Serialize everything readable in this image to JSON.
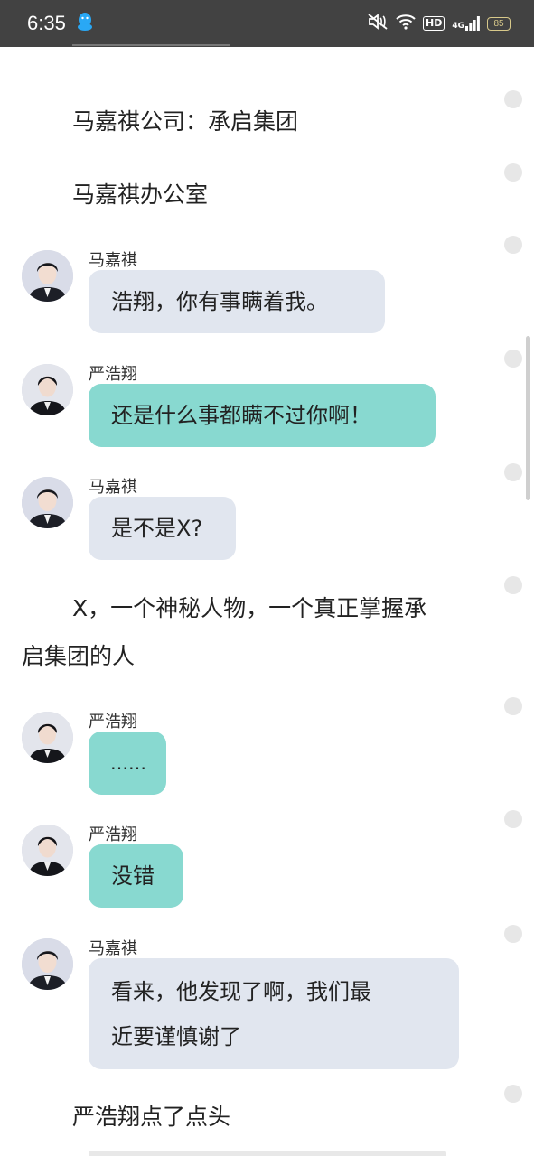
{
  "status_bar": {
    "time": "6:35",
    "hd": "HD",
    "network": "4G",
    "battery": "85",
    "icons": [
      "qq-icon",
      "mute-icon",
      "wifi-icon",
      "hd-icon",
      "signal-icon",
      "battery-icon"
    ]
  },
  "narration": {
    "company": "马嘉祺公司：承启集团",
    "office": "马嘉祺办公室",
    "x_intro_line1": "X，一个神秘人物，一个真正掌握承",
    "x_intro_line2": "启集团的人",
    "nod": "严浩翔点了点头"
  },
  "messages": [
    {
      "speaker": "马嘉祺",
      "text": "浩翔，你有事瞒着我。",
      "style": "gray"
    },
    {
      "speaker": "严浩翔",
      "text": "还是什么事都瞒不过你啊！",
      "style": "teal"
    },
    {
      "speaker": "马嘉祺",
      "text": "是不是X?",
      "style": "gray"
    },
    {
      "speaker": "严浩翔",
      "text": "……",
      "style": "teal"
    },
    {
      "speaker": "严浩翔",
      "text": "没错",
      "style": "teal"
    },
    {
      "speaker": "马嘉祺",
      "text_line1": "看来，他发现了啊，我们最",
      "text_line2": "近要谨慎谢了",
      "style": "gray"
    }
  ],
  "colors": {
    "status_bar_bg": "#424242",
    "bubble_gray": "#e1e6ef",
    "bubble_teal": "#88d9d0",
    "battery_outline": "#d8c98a",
    "comment_dot": "#e7e7e7"
  }
}
